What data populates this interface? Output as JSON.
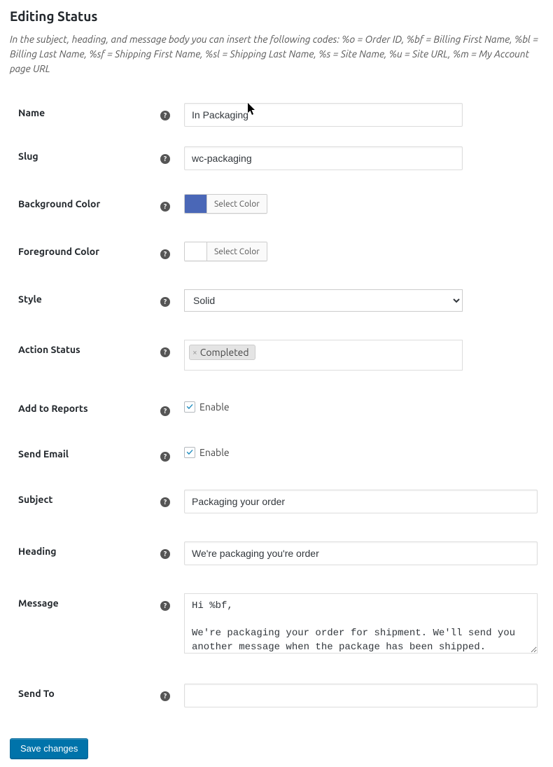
{
  "page": {
    "title": "Editing Status",
    "description": "In the subject, heading, and message body you can insert the following codes: %o = Order ID, %bf = Billing First Name, %bl = Billing Last Name, %sf = Shipping First Name, %sl = Shipping Last Name, %s = Site Name, %u = Site URL, %m = My Account page URL"
  },
  "labels": {
    "name": "Name",
    "slug": "Slug",
    "bgcolor": "Background Color",
    "fgcolor": "Foreground Color",
    "style": "Style",
    "action_status": "Action Status",
    "add_reports": "Add to Reports",
    "send_email": "Send Email",
    "subject": "Subject",
    "heading": "Heading",
    "message": "Message",
    "send_to": "Send To",
    "enable": "Enable",
    "select_color": "Select Color"
  },
  "fields": {
    "name": "In Packaging",
    "slug": "wc-packaging",
    "bgcolor": "#4a67b7",
    "fgcolor": "#ffffff",
    "style_selected": "Solid",
    "style_options": [
      "Solid"
    ],
    "action_status_tag": "Completed",
    "add_reports_checked": true,
    "send_email_checked": true,
    "subject": "Packaging your order",
    "heading": "We're packaging you're order",
    "message": "Hi %bf,\n\nWe're packaging your order for shipment. We'll send you another message when the package has been shipped.",
    "send_to": ""
  },
  "buttons": {
    "save": "Save changes"
  }
}
